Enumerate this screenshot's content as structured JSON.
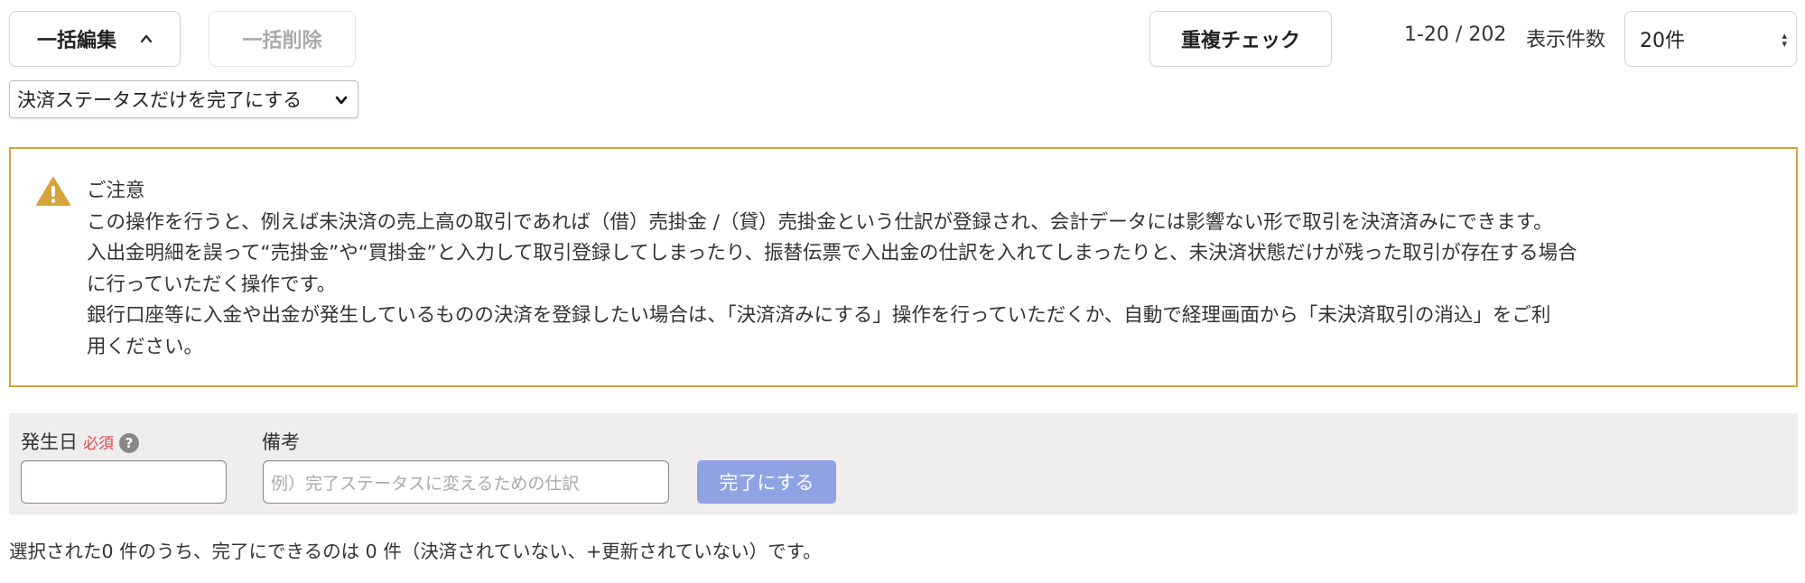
{
  "toolbar": {
    "bulk_edit_label": "一括編集",
    "bulk_delete_label": "一括削除",
    "duplicate_check_label": "重複チェック",
    "range_text": "1-20 / 202",
    "per_page_label": "表示件数",
    "per_page_value": "20件"
  },
  "action_select": {
    "selected": "決済ステータスだけを完了にする"
  },
  "notice": {
    "title": "ご注意",
    "lines": [
      "この操作を行うと、例えば未決済の売上高の取引であれば（借）売掛金 /（貸）売掛金という仕訳が登録され、会計データには影響ない形で取引を決済済みにできます。",
      "入出金明細を誤って“売掛金”や“買掛金”と入力して取引登録してしまったり、振替伝票で入出金の仕訳を入れてしまったりと、未決済状態だけが残った取引が存在する場合",
      "に行っていただく操作です。",
      "銀行口座等に入金や出金が発生しているものの決済を登録したい場合は、「決済済みにする」操作を行っていただくか、自動で経理画面から「未決済取引の消込」をご利",
      "用ください。"
    ],
    "border_color": "#d4a33a",
    "icon": "warning-triangle-icon"
  },
  "form": {
    "date_label": "発生日",
    "required_label": "必須",
    "help_icon": "question-circle-icon",
    "help_glyph": "?",
    "date_value": "",
    "note_label": "備考",
    "note_placeholder": "例）完了ステータスに変えるための仕訳",
    "submit_label": "完了にする",
    "submit_color": "#8ea2e4"
  },
  "summary_text": "選択された0 件のうち、完了にできるのは 0 件（決済されていない、+更新されていない）です。"
}
